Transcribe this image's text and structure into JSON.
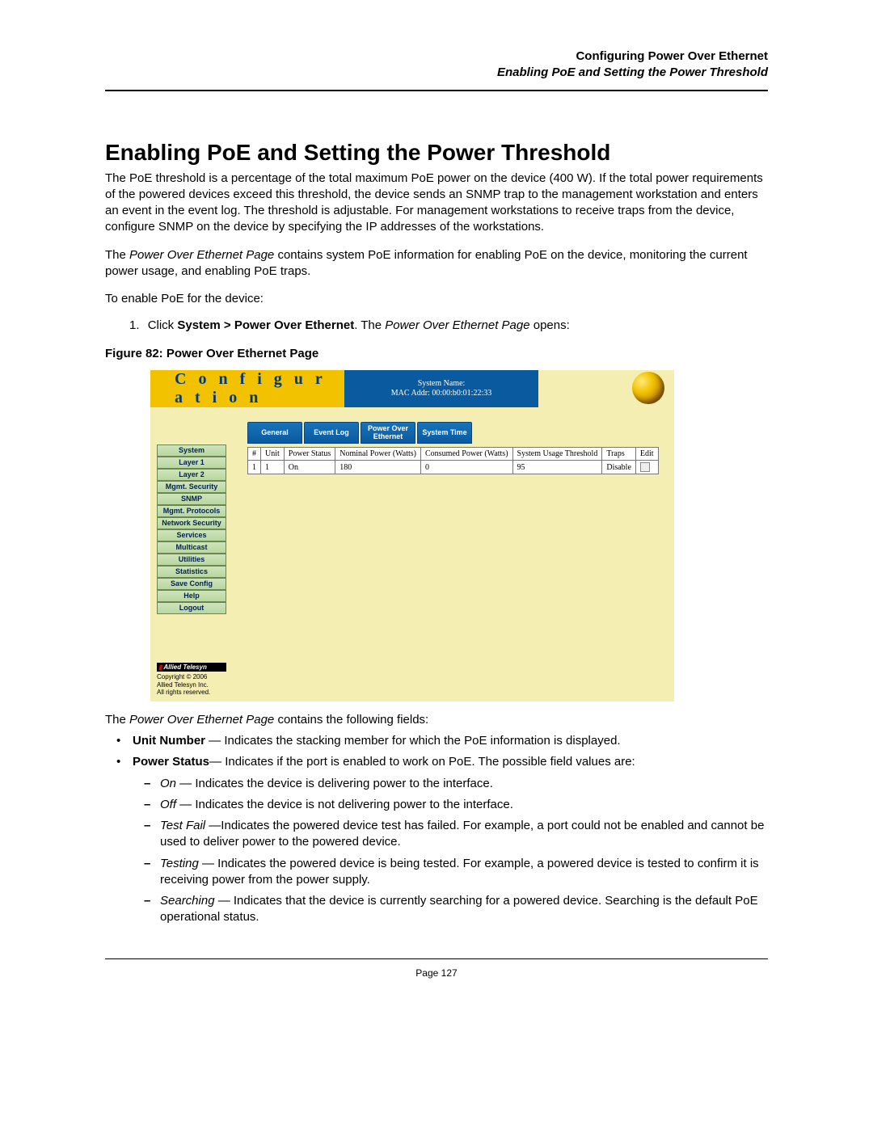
{
  "header": {
    "chapter": "Configuring Power Over Ethernet",
    "section": "Enabling PoE and Setting the Power Threshold"
  },
  "title": "Enabling PoE and Setting the Power Threshold",
  "paragraphs": {
    "p1": "The PoE threshold is a percentage of the total maximum PoE power on the device (400 W). If the total power requirements of the powered devices exceed this threshold, the device sends an SNMP trap to the management workstation and enters an event in the event log. The threshold is adjustable. For management workstations to receive traps from the device, configure SNMP on the device by specifying the IP addresses of the workstations.",
    "p2_pre": "The ",
    "p2_em": "Power Over Ethernet Page",
    "p2_post": " contains system PoE information for enabling PoE on the device, monitoring the current power usage, and enabling PoE traps.",
    "p3": "To enable PoE for the device:"
  },
  "step1": {
    "num": "1.",
    "lead": "Click ",
    "bold": "System > Power Over Ethernet",
    "mid": ". The ",
    "em": "Power Over Ethernet Page",
    "tail": " opens:"
  },
  "figure_caption": "Figure 82:  Power Over Ethernet Page",
  "screenshot": {
    "conf_title": "C o n f i g u r a t i o n",
    "sys_name": "System Name:",
    "mac": "MAC Addr:  00:00:b0:01:22:33",
    "tabs": [
      "General",
      "Event Log",
      "Power Over Ethernet",
      "System Time"
    ],
    "sidebar": [
      "System",
      "Layer 1",
      "Layer 2",
      "Mgmt. Security",
      "SNMP",
      "Mgmt. Protocols",
      "Network Security",
      "Services",
      "Multicast",
      "Utilities",
      "Statistics",
      "Save Config",
      "Help",
      "Logout"
    ],
    "brand": "Allied Telesyn",
    "copyright": [
      "Copyright © 2006",
      "Allied Telesyn Inc.",
      "All rights reserved."
    ],
    "table": {
      "headers": [
        "#",
        "Unit",
        "Power Status",
        "Nominal Power (Watts)",
        "Consumed Power (Watts)",
        "System Usage Threshold",
        "Traps",
        "Edit"
      ],
      "row": {
        "idx": "1",
        "unit": "1",
        "status": "On",
        "nominal": "180",
        "consumed": "0",
        "threshold": "95",
        "traps": "Disable"
      }
    }
  },
  "contains_line_pre": "The ",
  "contains_line_em": "Power Over Ethernet Page",
  "contains_line_post": " contains the following fields:",
  "fields": {
    "unit_number": {
      "term": "Unit Number",
      "desc": " — Indicates the stacking member for which the PoE information is displayed."
    },
    "power_status": {
      "term": "Power Status",
      "desc": "— Indicates if the port is enabled to work on PoE. The possible field values are:"
    },
    "values": {
      "on": {
        "name": "On",
        "desc": " — Indicates the device is delivering power to the interface."
      },
      "off": {
        "name": "Off",
        "desc": " — Indicates the device is not delivering power to the interface."
      },
      "testfail": {
        "name": "Test Fail",
        "desc": " —Indicates the powered device test has failed. For example, a port could not be enabled and cannot be used to deliver power to the powered device."
      },
      "testing": {
        "name": "Testing",
        "desc": " — Indicates the powered device is being tested. For example, a powered device is tested to confirm it is receiving power from the power supply."
      },
      "searching": {
        "name": "Searching",
        "desc": " — Indicates that the device is currently searching for a powered device. Searching is the default PoE operational status."
      }
    }
  },
  "footer": "Page 127"
}
